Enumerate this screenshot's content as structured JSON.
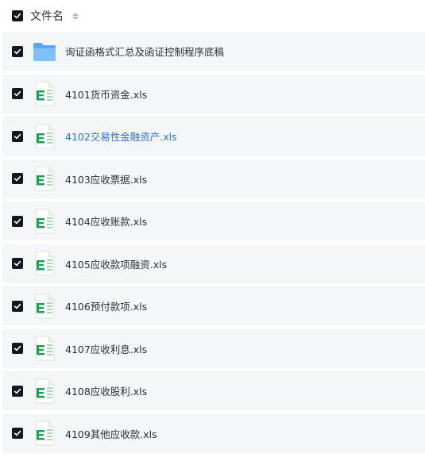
{
  "header": {
    "column_label": "文件名",
    "sort_icon": "sort-icon"
  },
  "files": [
    {
      "name": "询证函格式汇总及函证控制程序底稿",
      "type": "folder",
      "icon": "folder-icon",
      "checked": true
    },
    {
      "name": "4101货币资金.xls",
      "type": "excel",
      "icon": "excel-file-icon",
      "checked": true
    },
    {
      "name": "4102交易性金融资产.xls",
      "type": "excel",
      "icon": "excel-file-icon",
      "checked": true,
      "highlighted": true
    },
    {
      "name": "4103应收票据.xls",
      "type": "excel",
      "icon": "excel-file-icon",
      "checked": true
    },
    {
      "name": "4104应收账款.xls",
      "type": "excel",
      "icon": "excel-file-icon",
      "checked": true
    },
    {
      "name": "4105应收款项融资.xls",
      "type": "excel",
      "icon": "excel-file-icon",
      "checked": true
    },
    {
      "name": "4106预付款项.xls",
      "type": "excel",
      "icon": "excel-file-icon",
      "checked": true
    },
    {
      "name": "4107应收利息.xls",
      "type": "excel",
      "icon": "excel-file-icon",
      "checked": true
    },
    {
      "name": "4108应收股利.xls",
      "type": "excel",
      "icon": "excel-file-icon",
      "checked": true
    },
    {
      "name": "4109其他应收款.xls",
      "type": "excel",
      "icon": "excel-file-icon",
      "checked": true
    }
  ],
  "colors": {
    "accent": "#2f6fd6",
    "row_bg": "#f5f6f8",
    "excel_green": "#1f9d55",
    "folder_blue": "#5aa9f0"
  }
}
